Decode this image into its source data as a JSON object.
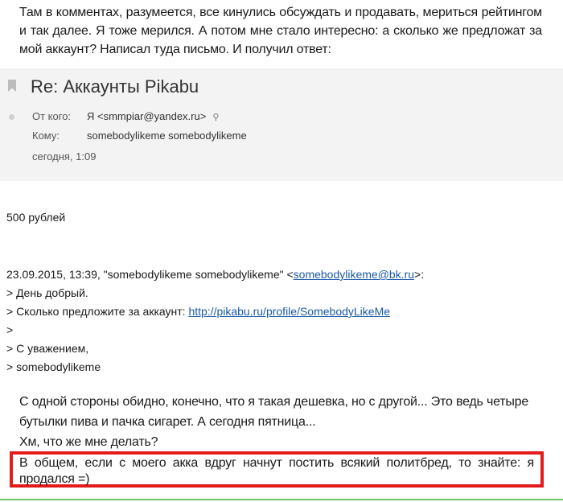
{
  "intro_text": "Там в комментах, разумеется, все кинулись обсуждать и продавать, мериться рейтингом и так далее. Я тоже мерился. А потом мне стало интересно: а сколько же предложат за мой аккаунт? Написал туда письмо. И получил ответ:",
  "email": {
    "subject": "Re: Аккаунты Pikabu",
    "from_label": "От кого:",
    "from_value": "Я <smmpiar@yandex.ru>",
    "to_label": "Кому:",
    "to_value": "somebodylikeme somebodylikeme",
    "date": "сегодня, 1:09",
    "body_price": "500 рублей",
    "quote_header_prefix": "23.09.2015, 13:39, \"somebodylikeme somebodylikeme\" <",
    "quote_header_email": "somebodylikeme@bk.ru",
    "quote_header_suffix": ">:",
    "quote_line1": "> День добрый.",
    "quote_line2_prefix": "> Сколько предложите за аккаунт: ",
    "quote_line2_link": "http://pikabu.ru/profile/SomebodyLikeMe",
    "quote_line3": ">",
    "quote_line4": "> С уважением,",
    "quote_line5": "> somebodylikeme"
  },
  "outro_line1": "С одной стороны обидно, конечно, что я такая дешевка, но с другой... Это ведь четыре бутылки пива и пачка сигарет. А сегодня пятница...",
  "outro_line2": "Хм, что же мне делать?",
  "highlight_text": "В общем, если с моего акка вдруг начнут постить всякий политбред, то знайте: я продался =)",
  "colors": {
    "highlight_border": "#e31b1b",
    "link": "#1a5aa8",
    "mail_header_bg": "#f3f3f3"
  }
}
